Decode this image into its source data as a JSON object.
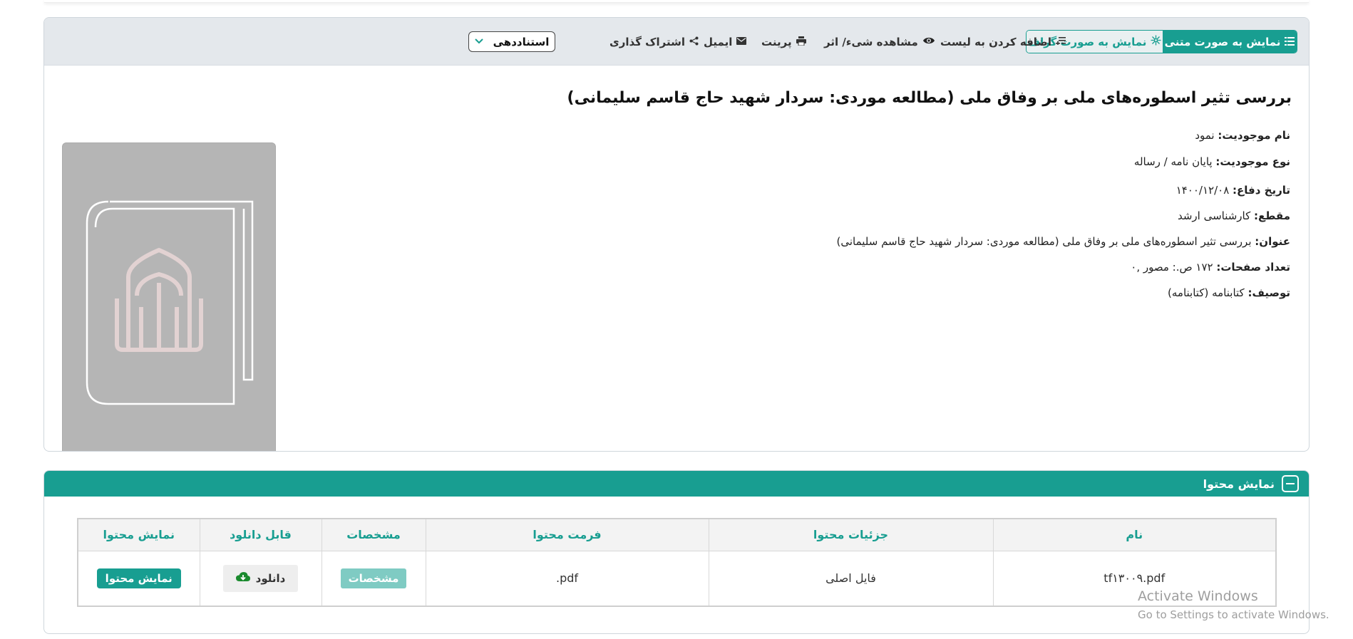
{
  "toolbar": {
    "view_text": "نمایش به صورت متنی",
    "view_graph": "نمایش به صورت گراف",
    "add_to_list": "اضافه کردن به لیست",
    "view_object": "مشاهده شیء/ اثر",
    "print": "پرینت",
    "email": "ایمیل",
    "share": "اشتراک گذاری",
    "cite": "استناددهی"
  },
  "record": {
    "title": "بررسی تثیر اسطوره‌های ملی بر وفاق ملی (مطالعه موردی: سردار شهید حاج قاسم سلیمانی)",
    "fields": [
      {
        "label": "نام موجودیت:",
        "value": "نمود"
      },
      {
        "label": "نوع موجودیت:",
        "value": "پایان نامه / رساله"
      },
      {
        "label": "تاریخ دفاع:",
        "value": "۱۴۰۰/۱۲/۰۸"
      },
      {
        "label": "مقطع:",
        "value": "کارشناسی ارشد"
      },
      {
        "label": "عنوان:",
        "value": "بررسی تثیر اسطوره‌های ملی بر وفاق ملی (مطالعه موردی: سردار شهید حاج قاسم سلیمانی)"
      },
      {
        "label": "تعداد صفحات:",
        "value": "۱۷۲ ص.: مصور ,۰"
      },
      {
        "label": "توصیف:",
        "value": "کتابنامه (کتابنامه)"
      }
    ]
  },
  "content": {
    "header": "نمایش محتوا",
    "columns": [
      "نام",
      "جزئیات محتوا",
      "فرمت محتوا",
      "مشخصات",
      "قابل دانلود",
      "نمایش محتوا"
    ],
    "rows": [
      {
        "name": "tf۱۳۰۰۹.pdf",
        "details": "فایل اصلی",
        "format": "pdf.",
        "specs_label": "مشخصات",
        "download_label": "دانلود",
        "show_label": "نمایش محتوا"
      }
    ]
  },
  "watermark": {
    "line1": "Activate Windows",
    "line2": "Go to Settings to activate Windows."
  },
  "colors": {
    "accent": "#189e91",
    "toolbar_bg": "#e4e8ec",
    "cover_bg": "#b5b5b5",
    "download_icon": "#1a8a2e"
  }
}
